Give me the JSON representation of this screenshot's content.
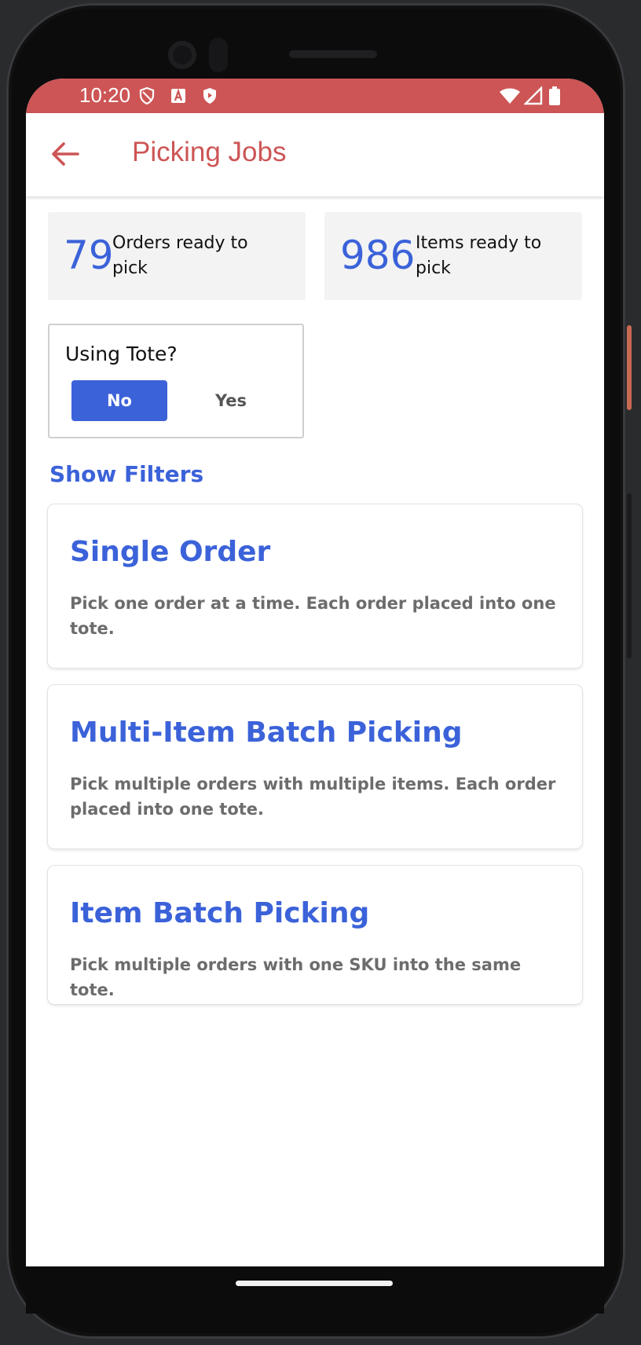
{
  "status_bar": {
    "time": "10:20",
    "color": "#cd5555"
  },
  "app_bar": {
    "title": "Picking Jobs",
    "back_icon": "arrow-left-icon"
  },
  "stats": [
    {
      "value": "79",
      "label": "Orders ready to pick"
    },
    {
      "value": "986",
      "label": "Items ready to pick"
    }
  ],
  "tote": {
    "question": "Using Tote?",
    "options": [
      "No",
      "Yes"
    ],
    "selected": "No"
  },
  "filters_link": "Show Filters",
  "jobs": [
    {
      "title": "Single Order",
      "description": "Pick one order at a time. Each order placed into one tote."
    },
    {
      "title": "Multi-Item Batch Picking",
      "description": "Pick multiple orders with multiple items. Each order placed into one tote."
    },
    {
      "title": "Item Batch Picking",
      "description": "Pick multiple orders with one SKU into the same tote."
    }
  ],
  "colors": {
    "accent": "#3b62d9",
    "brand": "#cd5555"
  }
}
